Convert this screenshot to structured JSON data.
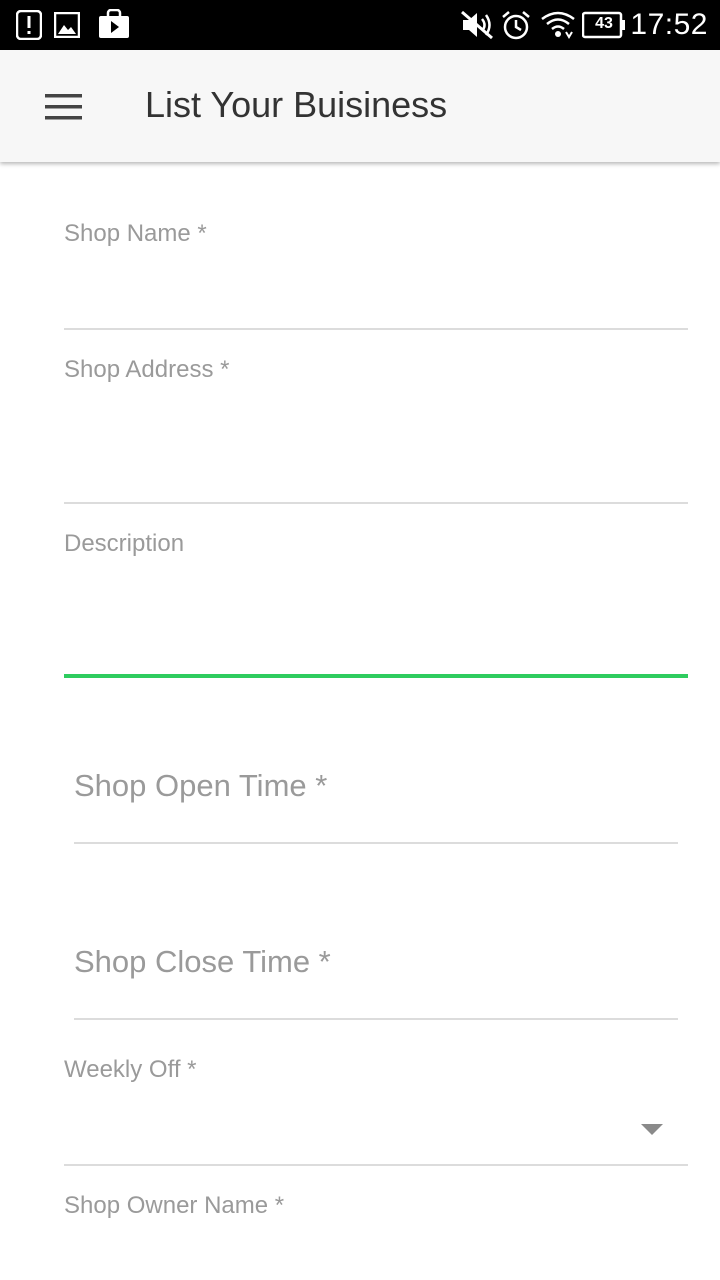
{
  "status_bar": {
    "time": "17:52",
    "battery_level": "43",
    "icons": [
      "alert-icon",
      "gallery-icon",
      "play-store-icon",
      "vibrate-off-icon",
      "alarm-icon",
      "wifi-icon",
      "battery-icon"
    ]
  },
  "app_bar": {
    "title": "List Your Buisiness",
    "menu_icon": "hamburger-menu-icon"
  },
  "form": {
    "shop_name": {
      "label": "Shop Name *",
      "value": ""
    },
    "shop_address": {
      "label": "Shop Address *",
      "value": ""
    },
    "description": {
      "label": "Description",
      "value": ""
    },
    "shop_open_time": {
      "label": "Shop Open Time *",
      "value": ""
    },
    "shop_close_time": {
      "label": "Shop Close Time *",
      "value": ""
    },
    "weekly_off": {
      "label": "Weekly Off *",
      "selected": ""
    },
    "shop_owner_name": {
      "label": "Shop Owner Name *",
      "value": ""
    }
  },
  "colors": {
    "status_bar_bg": "#000000",
    "app_bar_bg": "#f7f7f7",
    "focus_accent": "#2ecc5f",
    "label_text": "#9a9a9a",
    "divider": "#dcdcdc"
  }
}
